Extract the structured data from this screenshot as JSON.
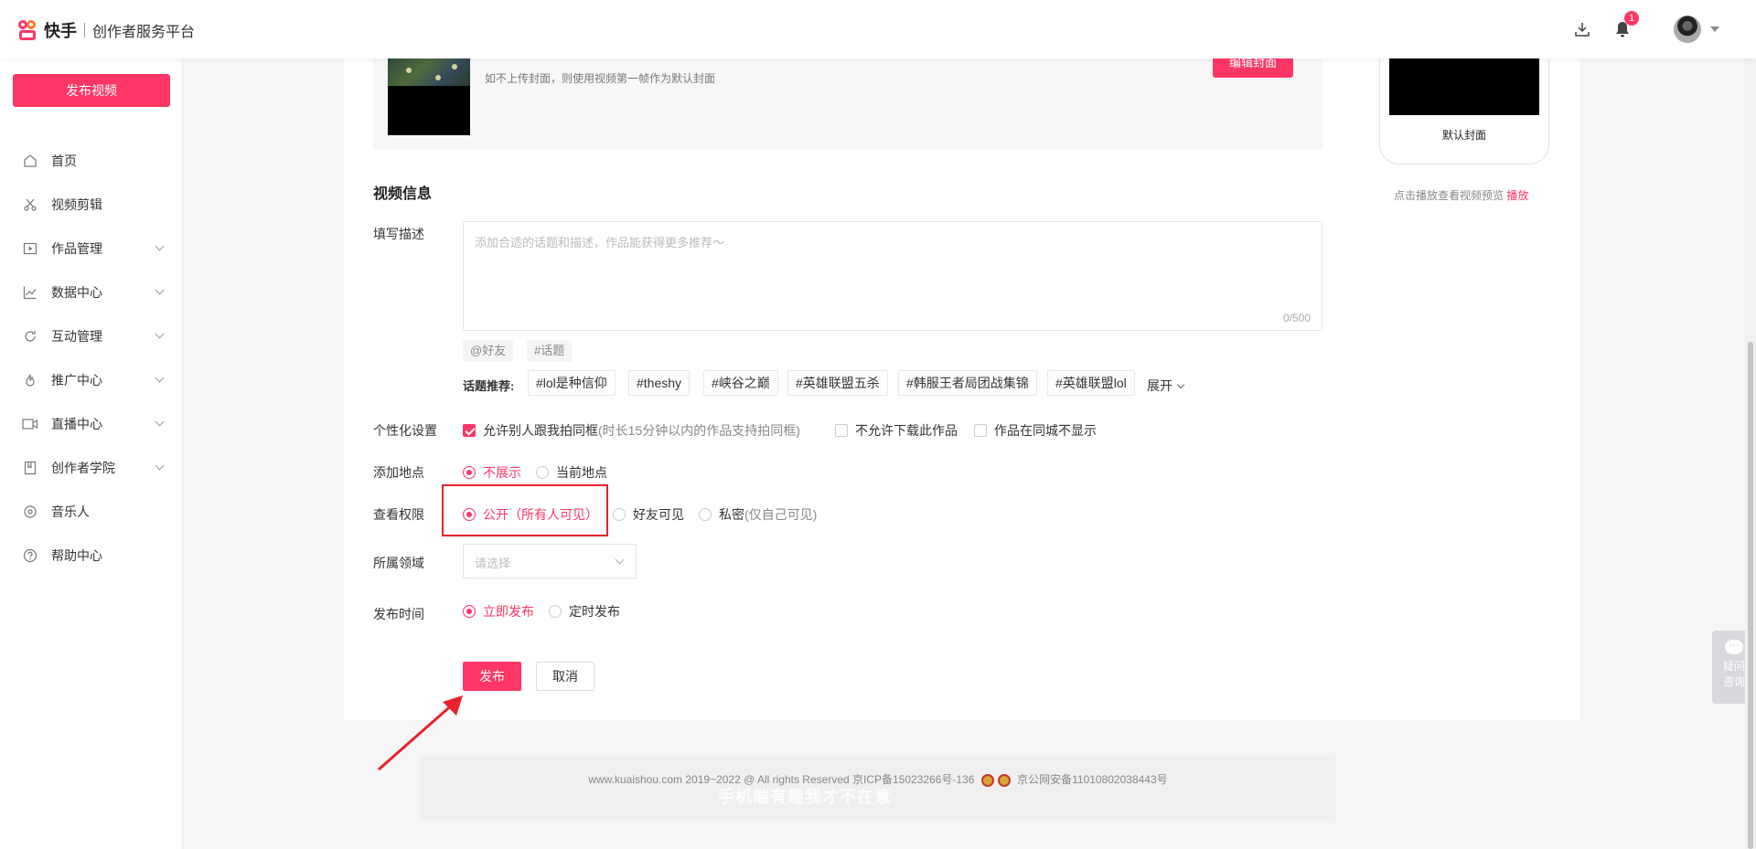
{
  "header": {
    "brand": "快手",
    "platform": "创作者服务平台",
    "notification_count": "1",
    "icons": [
      "download-icon",
      "bell-icon"
    ]
  },
  "sidebar": {
    "publish_label": "发布视频",
    "items": [
      {
        "label": "首页",
        "icon": "home-icon",
        "expandable": false
      },
      {
        "label": "视频剪辑",
        "icon": "scissors-icon",
        "expandable": false
      },
      {
        "label": "作品管理",
        "icon": "play-box-icon",
        "expandable": true
      },
      {
        "label": "数据中心",
        "icon": "chart-icon",
        "expandable": true
      },
      {
        "label": "互动管理",
        "icon": "refresh-icon",
        "expandable": true
      },
      {
        "label": "推广中心",
        "icon": "flame-icon",
        "expandable": true
      },
      {
        "label": "直播中心",
        "icon": "camera-icon",
        "expandable": true
      },
      {
        "label": "创作者学院",
        "icon": "book-icon",
        "expandable": true
      },
      {
        "label": "音乐人",
        "icon": "music-disc-icon",
        "expandable": false
      },
      {
        "label": "帮助中心",
        "icon": "help-icon",
        "expandable": false
      }
    ]
  },
  "cover": {
    "tip": "如不上传封面，则使用视频第一帧作为默认封面",
    "edit_label": "编辑封面",
    "preview_label": "默认封面",
    "preview_tip": "点击播放查看视频预览",
    "play_link": "播放"
  },
  "video_info": {
    "title": "视频信息",
    "desc_label": "填写描述",
    "desc_placeholder": "添加合适的话题和描述，作品能获得更多推荐～",
    "desc_count": "0/500",
    "mention_btn": "@好友",
    "topic_btn": "#话题",
    "rec_label": "话题推荐:",
    "rec_tags": [
      "#lol是种信仰",
      "#theshy",
      "#峡谷之巅",
      "#英雄联盟五杀",
      "#韩服王者局团战集锦",
      "#英雄联盟lol"
    ],
    "expand_label": "展开"
  },
  "personal": {
    "label": "个性化设置",
    "opt1": "允许别人跟我拍同框",
    "opt1_hint": "(时长15分钟以内的作品支持拍同框)",
    "opt2": "不允许下载此作品",
    "opt3": "作品在同城不显示"
  },
  "location": {
    "label": "添加地点",
    "opt1": "不展示",
    "opt2": "当前地点"
  },
  "permission": {
    "label": "查看权限",
    "opt1": "公开（所有人可见）",
    "opt2": "好友可见",
    "opt3": "私密",
    "opt3_hint": "(仅自己可见)"
  },
  "domain": {
    "label": "所属领域",
    "placeholder": "请选择"
  },
  "schedule": {
    "label": "发布时间",
    "opt1": "立即发布",
    "opt2": "定时发布"
  },
  "actions": {
    "publish": "发布",
    "cancel": "取消"
  },
  "footer": {
    "copyright": "www.kuaishou.com 2019~2022 @ All rights Reserved 京ICP备15023266号-136",
    "police": "京公网安备11010802038443号",
    "watermark": "手机端有趣我才不在意"
  },
  "help_float": {
    "line1": "疑问",
    "line2": "咨询"
  },
  "colors": {
    "accent": "#fe3666",
    "annotation": "#e8222c"
  }
}
